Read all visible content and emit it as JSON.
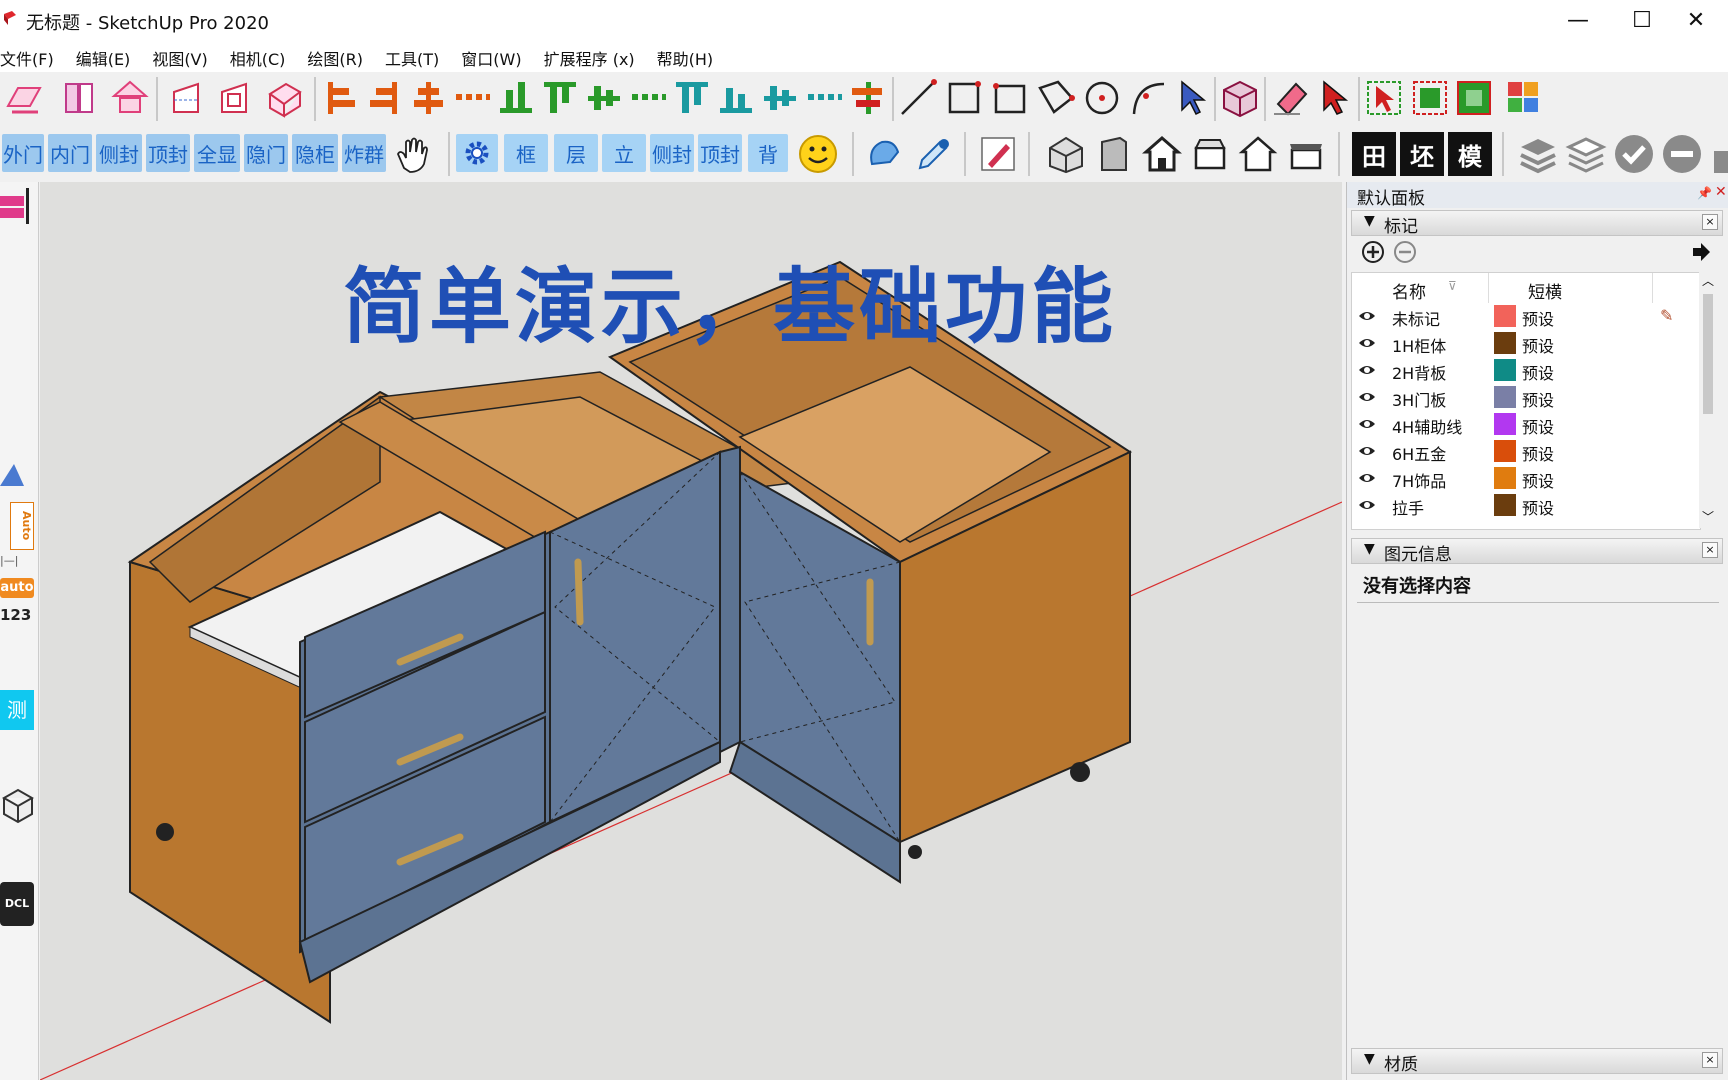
{
  "window": {
    "title": "无标题 - SketchUp Pro 2020",
    "minimize": "—",
    "maximize": "☐",
    "close": "✕"
  },
  "menu": [
    "文件(F)",
    "编辑(E)",
    "视图(V)",
    "相机(C)",
    "绘图(R)",
    "工具(T)",
    "窗口(W)",
    "扩展程序 (x)",
    "帮助(H)"
  ],
  "toolbar2": {
    "buttons_a": [
      "外门",
      "内门",
      "侧封",
      "顶封",
      "全显",
      "隐门",
      "隐柜",
      "炸群"
    ],
    "buttons_b": [
      "框",
      "层",
      "立",
      "侧封",
      "顶封",
      "背"
    ],
    "buttons_c": [
      "田",
      "坯",
      "模"
    ]
  },
  "leftbar": {
    "auto_label": "Auto",
    "auto2_label": "auto",
    "num_label": "123",
    "test_label": "测试",
    "dcl_label": "DCL"
  },
  "viewport": {
    "headline": "简单演示，基础功能"
  },
  "panel": {
    "title": "默认面板",
    "tags_section": "标记",
    "col_name": "名称",
    "col_dash": "短横",
    "tags": [
      {
        "name": "未标记",
        "color": "#f2635a",
        "dash": "预设"
      },
      {
        "name": "1H柜体",
        "color": "#6b3d0e",
        "dash": "预设"
      },
      {
        "name": "2H背板",
        "color": "#0f8b86",
        "dash": "预设"
      },
      {
        "name": "3H门板",
        "color": "#7a7fa6",
        "dash": "预设"
      },
      {
        "name": "4H辅助线",
        "color": "#b238f0",
        "dash": "预设"
      },
      {
        "name": "6H五金",
        "color": "#d94e0b",
        "dash": "预设"
      },
      {
        "name": "7H饰品",
        "color": "#e07c0f",
        "dash": "预设"
      },
      {
        "name": "拉手",
        "color": "#6b3d0e",
        "dash": "预设"
      }
    ],
    "entity_section": "图元信息",
    "entity_text": "没有选择内容",
    "materials_section": "材质"
  }
}
